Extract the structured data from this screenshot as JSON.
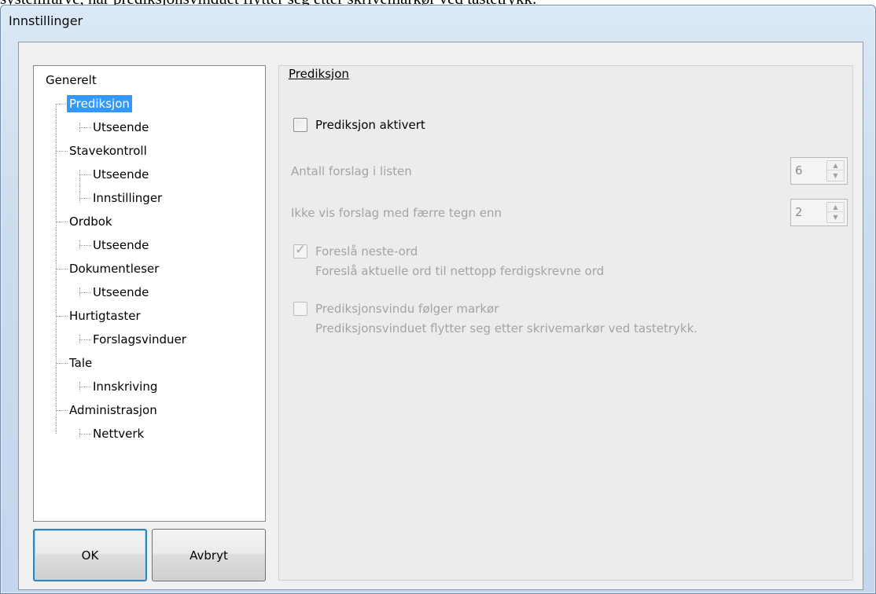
{
  "background_text": "systemfarve, når prediksjonsvinduet flytter seg etter skrivemarkør ved tastetrykk.",
  "window": {
    "title": "Innstillinger"
  },
  "tree": {
    "items": [
      {
        "label": "Generelt",
        "level": 0,
        "selected": false
      },
      {
        "label": "Prediksjon",
        "level": 1,
        "selected": true
      },
      {
        "label": "Utseende",
        "level": 2,
        "selected": false
      },
      {
        "label": "Stavekontroll",
        "level": 1,
        "selected": false
      },
      {
        "label": "Utseende",
        "level": 2,
        "selected": false
      },
      {
        "label": "Innstillinger",
        "level": 2,
        "selected": false
      },
      {
        "label": "Ordbok",
        "level": 1,
        "selected": false
      },
      {
        "label": "Utseende",
        "level": 2,
        "selected": false
      },
      {
        "label": "Dokumentleser",
        "level": 1,
        "selected": false
      },
      {
        "label": "Utseende",
        "level": 2,
        "selected": false
      },
      {
        "label": "Hurtigtaster",
        "level": 1,
        "selected": false
      },
      {
        "label": "Forslagsvinduer",
        "level": 2,
        "selected": false
      },
      {
        "label": "Tale",
        "level": 1,
        "selected": false
      },
      {
        "label": "Innskriving",
        "level": 2,
        "selected": false
      },
      {
        "label": "Administrasjon",
        "level": 1,
        "selected": false
      },
      {
        "label": "Nettverk",
        "level": 2,
        "selected": false
      }
    ]
  },
  "buttons": {
    "ok": "OK",
    "cancel": "Avbryt"
  },
  "panel": {
    "title": "Prediksjon",
    "prediction_enabled": {
      "label": "Prediksjon aktivert",
      "checked": false
    },
    "suggestion_count": {
      "label": "Antall forslag i listen",
      "value": "6"
    },
    "min_chars": {
      "label": "Ikke vis forslag med færre tegn enn",
      "value": "2"
    },
    "next_word": {
      "label": "Foreslå neste-ord",
      "description": "Foreslå aktuelle ord til nettopp ferdigskrevne ord",
      "checked": true
    },
    "follow_cursor": {
      "label": "Prediksjonsvindu følger markør",
      "description": "Prediksjonsvinduet flytter seg etter skrivemarkør ved tastetrykk.",
      "checked": false
    }
  },
  "colors": {
    "selection": "#3399ff",
    "disabled_text": "#a3a3a3",
    "window_frame": "#c3d6ec"
  }
}
